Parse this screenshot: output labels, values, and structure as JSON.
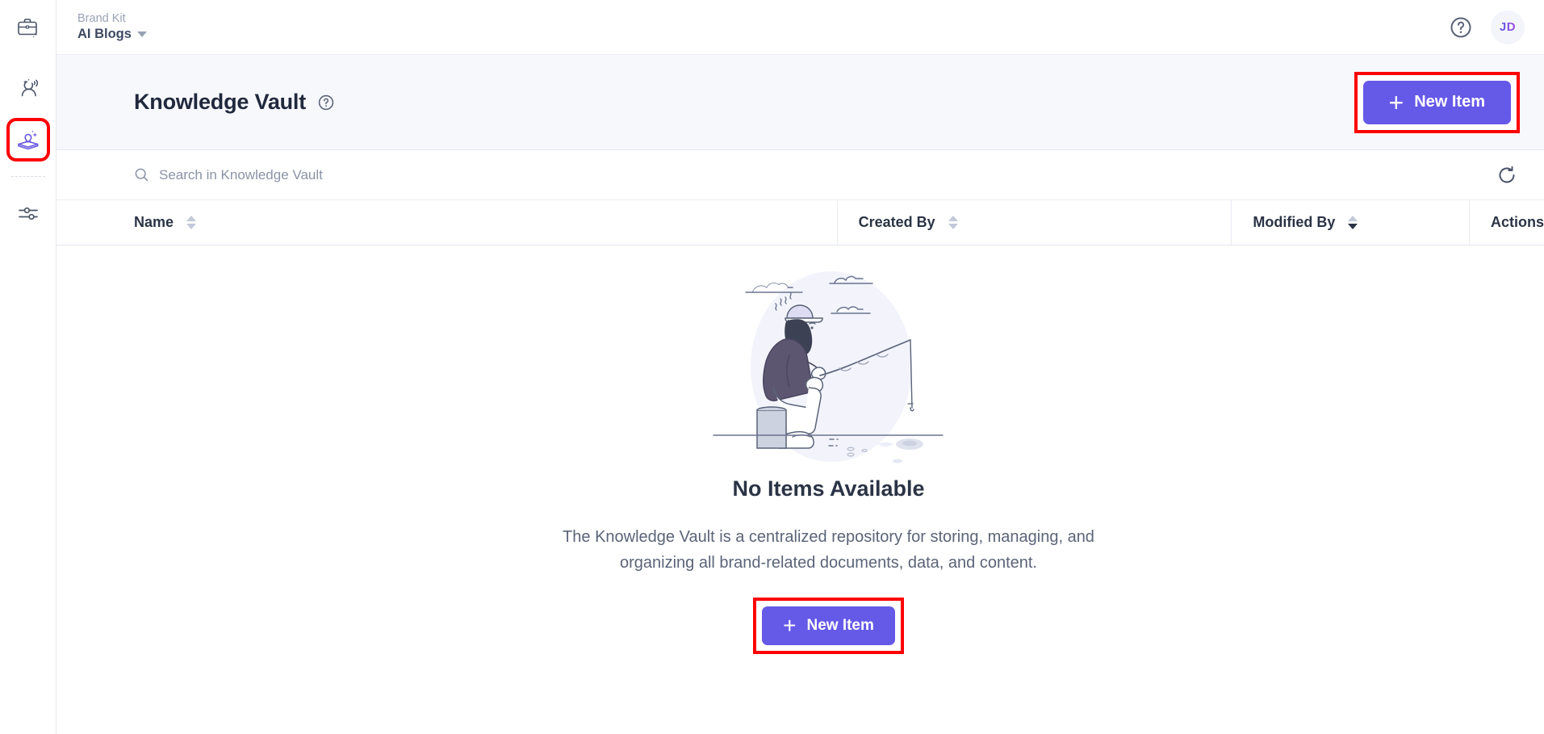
{
  "app": {
    "accent_color": "#6559e8",
    "highlight_color": "#ff0000",
    "header_band_color": "#f7f8fc"
  },
  "rail": {
    "logo_icon": "briefcase-sparkle-icon",
    "items": [
      {
        "icon": "ai-persona-icon",
        "name": "sidebar-item-persona",
        "active": false
      },
      {
        "icon": "knowledge-book-bulb-icon",
        "name": "sidebar-item-knowledge-vault",
        "active": true
      },
      {
        "icon": "sliders-settings-icon",
        "name": "sidebar-item-settings",
        "active": false
      }
    ]
  },
  "topbar": {
    "brand_kit_label": "Brand Kit",
    "brand_name": "AI Blogs",
    "caret_icon": "chevron-down-icon",
    "help_icon": "question-circle-icon",
    "avatar_initials": "JD"
  },
  "page": {
    "title": "Knowledge Vault",
    "title_help_icon": "question-circle-icon",
    "new_item_label": "New Item",
    "new_item_plus_icon": "plus-icon"
  },
  "search": {
    "placeholder": "Search in Knowledge Vault",
    "value": "",
    "search_icon": "search-icon",
    "refresh_icon": "refresh-icon"
  },
  "table": {
    "columns": [
      {
        "label": "Name",
        "sortable": true,
        "sort": "none"
      },
      {
        "label": "Created By",
        "sortable": true,
        "sort": "none"
      },
      {
        "label": "Modified By",
        "sortable": true,
        "sort": "desc"
      },
      {
        "label": "Actions",
        "sortable": false,
        "sort": "none"
      }
    ],
    "rows": []
  },
  "empty_state": {
    "illustration": "fisherman-illustration",
    "title": "No Items Available",
    "description": "The Knowledge Vault is a centralized repository for storing, managing, and organizing all brand-related documents, data, and content.",
    "button_label": "New Item",
    "button_plus_icon": "plus-icon"
  }
}
